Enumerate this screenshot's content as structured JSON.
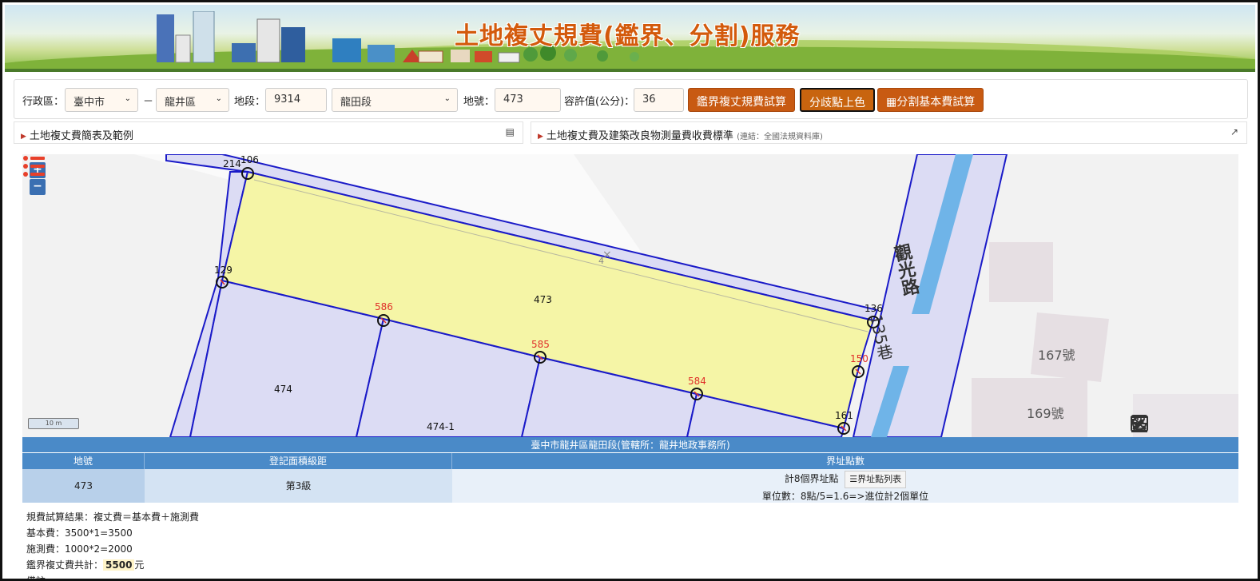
{
  "banner": {
    "title": "土地複丈規費(鑑界、分割)服務"
  },
  "toolbar": {
    "district_label": "行政區：",
    "city_value": "臺中市",
    "dash": "－",
    "area_value": "龍井區",
    "section_label": "地段：",
    "section_code": "9314",
    "section_name": "龍田段",
    "lot_label": "地號：",
    "lot_value": "473",
    "tolerance_label": "容許值(公分)：",
    "tolerance_value": "36",
    "btn_survey": "鑑界複丈規費試算",
    "btn_color": "分歧點上色",
    "btn_split": "分割基本費試算"
  },
  "collapsibles": {
    "left": "土地複丈費簡表及範例",
    "right_main": "土地複丈費及建築改良物測量費收費標準",
    "right_note": "(連結：全國法規資料庫)"
  },
  "map": {
    "zoom_in": "+",
    "zoom_out": "−",
    "scale_label": "10 m",
    "parcels": {
      "p473": "473",
      "p474": "474",
      "p474_1": "474-1"
    },
    "points": {
      "p214": "214",
      "p106": "106",
      "p129": "129",
      "p586": "586",
      "p585": "585",
      "p584": "584",
      "p136": "136",
      "p150": "150",
      "p161": "161"
    },
    "road_name": "觀光路",
    "road_lane": "135巷",
    "house_167": "167號",
    "house_169": "169號",
    "mark_4": "4",
    "colors": {
      "selected_fill": "#f5f5a6",
      "neighbor_fill": "#dcdcf4",
      "boundary": "#1a1ac8",
      "point_red": "#e0302a"
    }
  },
  "table": {
    "header": "臺中市龍井區龍田段(管轄所：龍井地政事務所)",
    "col_lot": "地號",
    "col_grade": "登記面積級距",
    "col_points": "界址點數",
    "lot": "473",
    "grade": "第3級",
    "points_count": "計8個界址點",
    "points_btn": "☰界址點列表",
    "units": "單位數：8點/5=1.6=>進位計2個單位"
  },
  "result": {
    "line1": "規費試算結果：複丈費＝基本費＋施測費",
    "line2": "基本費：3500*1=3500",
    "line3": "施測費：1000*2=2000",
    "line4_label": "鑑界複丈費共計：",
    "line4_value": "5500",
    "line4_unit": "元",
    "line5": "備註"
  }
}
